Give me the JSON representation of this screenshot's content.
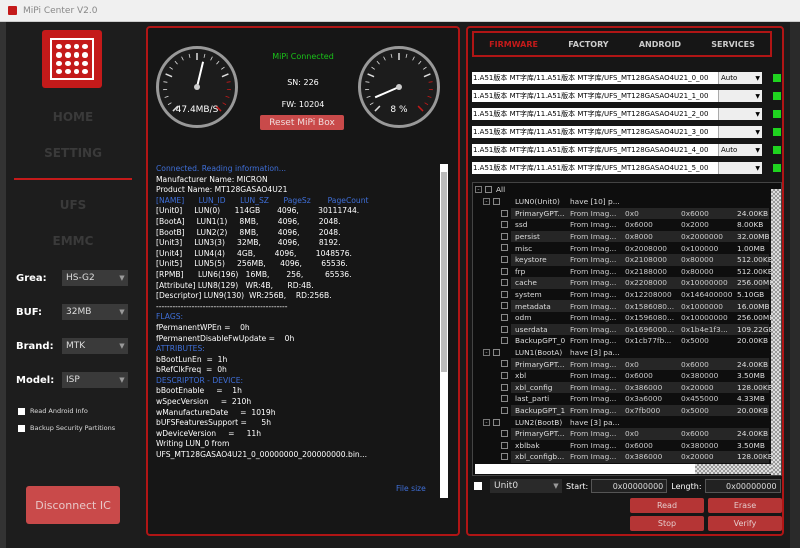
{
  "window": {
    "title": "MiPi Center V2.0"
  },
  "sidebar": {
    "nav": [
      "HOME",
      "SETTING",
      "UFS",
      "EMMC"
    ],
    "fields": [
      {
        "label": "Grea:",
        "value": "HS-G2"
      },
      {
        "label": "BUF:",
        "value": "32MB"
      },
      {
        "label": "Brand:",
        "value": "MTK"
      },
      {
        "label": "Model:",
        "value": "ISP"
      }
    ],
    "checks": [
      "Read Android Info",
      "Backup Security Partitions"
    ],
    "disconnect": "Disconnect IC"
  },
  "status": {
    "speed": "47.4MB/S",
    "percent": "8 %",
    "connected": "MiPi Connected",
    "sn": "SN: 226",
    "fw": "FW: 10204",
    "reset": "Reset MiPi Box",
    "file_size": "File size",
    "speed_needle_fraction": 0.55,
    "percent_needle_fraction": 0.08
  },
  "log": [
    {
      "t": "Connected. Reading information...",
      "c": "b"
    },
    {
      "t": "Manufacturer Name: MICRON",
      "c": "w"
    },
    {
      "t": "Product Name: MT128GASAO4U21",
      "c": "w"
    },
    {
      "t": "[NAME]      LUN_ID      LUN_SZ      PageSz       PageCount",
      "c": "b"
    },
    {
      "t": "[Unit0]     LUN(0)      114GB       4096,        30111744.",
      "c": "w"
    },
    {
      "t": "[BootA]     LUN1(1)     8MB,        4096,        2048.",
      "c": "w"
    },
    {
      "t": "[BootB]     LUN2(2)     8MB,        4096,        2048.",
      "c": "w"
    },
    {
      "t": "[Unit3]     LUN3(3)     32MB,       4096,        8192.",
      "c": "w"
    },
    {
      "t": "[Unit4]     LUN4(4)     4GB,        4096,        1048576.",
      "c": "w"
    },
    {
      "t": "[Unit5]     LUN5(5)     256MB,      4096,        65536.",
      "c": "w"
    },
    {
      "t": "[RPMB]      LUN6(196)   16MB,       256,         65536.",
      "c": "w"
    },
    {
      "t": "[Attribute] LUN8(129)   WR:4B,      RD:4B.",
      "c": "w"
    },
    {
      "t": "[Descriptor] LUN9(130)  WR:256B,    RD:256B.",
      "c": "w"
    },
    {
      "t": "------------------------------------------------",
      "c": "w"
    },
    {
      "t": "FLAGS:",
      "c": "b"
    },
    {
      "t": "fPermanentWPEn =    0h",
      "c": "w"
    },
    {
      "t": "fPermanentDisableFwUpdate =    0h",
      "c": "w"
    },
    {
      "t": "ATTRIBUTES:",
      "c": "b"
    },
    {
      "t": "bBootLunEn  =  1h",
      "c": "w"
    },
    {
      "t": "bRefClkFreq  =  0h",
      "c": "w"
    },
    {
      "t": "DESCRIPTOR - DEVICE:",
      "c": "b"
    },
    {
      "t": "bBootEnable     =    1h",
      "c": "w"
    },
    {
      "t": "wSpecVersion     =  210h",
      "c": "w"
    },
    {
      "t": "wManufactureDate     =  1019h",
      "c": "w"
    },
    {
      "t": "bUFSFeaturesSupport =      5h",
      "c": "w"
    },
    {
      "t": "wDeviceVersion     =     11h",
      "c": "w"
    },
    {
      "t": "Writing LUN_0 from",
      "c": "w"
    },
    {
      "t": "UFS_MT128GASAO4U21_0_00000000_200000000.bin...",
      "c": "w"
    }
  ],
  "right": {
    "tabs": [
      "FIRMWARE",
      "FACTORY",
      "ANDROID",
      "SERVICES"
    ],
    "files": [
      {
        "t": "1.A51版本  MT字库/11.A51版本  MT字库/UFS_MT128GASAO4U21_0_00",
        "auto": "Auto"
      },
      {
        "t": "1.A51版本  MT字库/11.A51版本  MT字库/UFS_MT128GASAO4U21_1_00",
        "auto": ""
      },
      {
        "t": "1.A51版本  MT字库/11.A51版本  MT字库/UFS_MT128GASAO4U21_2_00",
        "auto": ""
      },
      {
        "t": "1.A51版本  MT字库/11.A51版本  MT字库/UFS_MT128GASAO4U21_3_00",
        "auto": ""
      },
      {
        "t": "1.A51版本  MT字库/11.A51版本  MT字库/UFS_MT128GASAO4U21_4_00",
        "auto": "Auto"
      },
      {
        "t": "1.A51版本  MT字库/11.A51版本  MT字库/UFS_MT128GASAO4U21_5_00",
        "auto": ""
      }
    ],
    "tree_all": "All",
    "tree": [
      {
        "kind": "lun",
        "name": "LUN0(Unit0)",
        "info": "have [10] p..."
      },
      {
        "kind": "part",
        "name": "PrimaryGPT...",
        "from": "From Imag...",
        "start": "0x0",
        "size": "0x6000",
        "len": "24.00KB",
        "hl": true
      },
      {
        "kind": "part",
        "name": "ssd",
        "from": "From Imag...",
        "start": "0x6000",
        "size": "0x2000",
        "len": "8.00KB",
        "hl": false
      },
      {
        "kind": "part",
        "name": "persist",
        "from": "From Imag...",
        "start": "0x8000",
        "size": "0x2000000",
        "len": "32.00MB",
        "hl": true
      },
      {
        "kind": "part",
        "name": "misc",
        "from": "From Imag...",
        "start": "0x2008000",
        "size": "0x100000",
        "len": "1.00MB",
        "hl": false
      },
      {
        "kind": "part",
        "name": "keystore",
        "from": "From Imag...",
        "start": "0x2108000",
        "size": "0x80000",
        "len": "512.00KB",
        "hl": true
      },
      {
        "kind": "part",
        "name": "frp",
        "from": "From Imag...",
        "start": "0x2188000",
        "size": "0x80000",
        "len": "512.00KB",
        "hl": false
      },
      {
        "kind": "part",
        "name": "cache",
        "from": "From Imag...",
        "start": "0x2208000",
        "size": "0x10000000",
        "len": "256.00MB",
        "hl": true
      },
      {
        "kind": "part",
        "name": "system",
        "from": "From Imag...",
        "start": "0x12208000",
        "size": "0x146400000",
        "len": "5.10GB",
        "hl": false
      },
      {
        "kind": "part",
        "name": "metadata",
        "from": "From Imag...",
        "start": "0x1586080...",
        "size": "0x1000000",
        "len": "16.00MB",
        "hl": true
      },
      {
        "kind": "part",
        "name": "odm",
        "from": "From Imag...",
        "start": "0x1596080...",
        "size": "0x10000000",
        "len": "256.00MB",
        "hl": false
      },
      {
        "kind": "part",
        "name": "userdata",
        "from": "From Imag...",
        "start": "0x1696000...",
        "size": "0x1b4e1f3...",
        "len": "109.22GB",
        "hl": true
      },
      {
        "kind": "part",
        "name": "BackupGPT_0",
        "from": "From Imag...",
        "start": "0x1cb77fb...",
        "size": "0x5000",
        "len": "20.00KB",
        "hl": false
      },
      {
        "kind": "lun",
        "name": "LUN1(BootA)",
        "info": "have [3] pa..."
      },
      {
        "kind": "part",
        "name": "PrimaryGPT...",
        "from": "From Imag...",
        "start": "0x0",
        "size": "0x6000",
        "len": "24.00KB",
        "hl": true
      },
      {
        "kind": "part",
        "name": "xbl",
        "from": "From Imag...",
        "start": "0x6000",
        "size": "0x380000",
        "len": "3.50MB",
        "hl": false
      },
      {
        "kind": "part",
        "name": "xbl_config",
        "from": "From Imag...",
        "start": "0x386000",
        "size": "0x20000",
        "len": "128.00KB",
        "hl": true
      },
      {
        "kind": "part",
        "name": "last_parti",
        "from": "From Imag...",
        "start": "0x3a6000",
        "size": "0x455000",
        "len": "4.33MB",
        "hl": false
      },
      {
        "kind": "part",
        "name": "BackupGPT_1",
        "from": "From Imag...",
        "start": "0x7fb000",
        "size": "0x5000",
        "len": "20.00KB",
        "hl": true
      },
      {
        "kind": "lun",
        "name": "LUN2(BootB)",
        "info": "have [3] pa..."
      },
      {
        "kind": "part",
        "name": "PrimaryGPT...",
        "from": "From Imag...",
        "start": "0x0",
        "size": "0x6000",
        "len": "24.00KB",
        "hl": true
      },
      {
        "kind": "part",
        "name": "xblbak",
        "from": "From Imag...",
        "start": "0x6000",
        "size": "0x380000",
        "len": "3.50MB",
        "hl": false
      },
      {
        "kind": "part",
        "name": "xbl_configb...",
        "from": "From Imag...",
        "start": "0x386000",
        "size": "0x20000",
        "len": "128.00KB",
        "hl": true
      }
    ],
    "unit": "Unit0",
    "start_label": "Start:",
    "start_value": "0x00000000",
    "length_label": "Length:",
    "length_value": "0x00000000",
    "buttons": [
      "Read",
      "Erase",
      "Stop",
      "Verify"
    ]
  },
  "colors": {
    "accent": "#c41a1a",
    "ok": "#19c319",
    "link": "#3f6fd8"
  }
}
